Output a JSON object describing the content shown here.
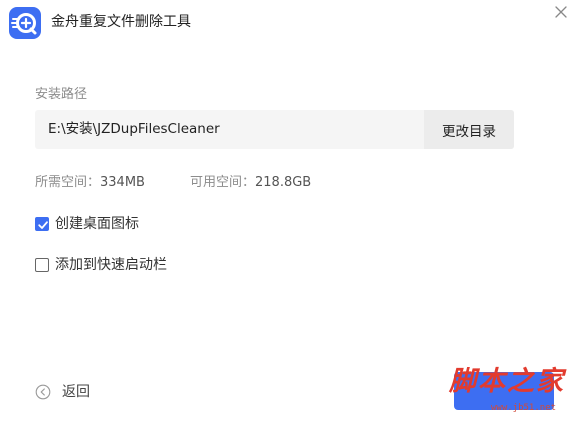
{
  "window": {
    "title": "金舟重复文件删除工具",
    "logo_icon": "app-logo-icon",
    "close_icon": "close-icon"
  },
  "install_path": {
    "label": "安装路径",
    "value": "E:\\安装\\JZDupFilesCleaner",
    "change_button": "更改目录"
  },
  "space": {
    "required_label": "所需空间：",
    "required_value": "334MB",
    "available_label": "可用空间：",
    "available_value": "218.8GB"
  },
  "options": [
    {
      "label": "创建桌面图标",
      "checked": true
    },
    {
      "label": "添加到快速启动栏",
      "checked": false
    }
  ],
  "footer": {
    "back_label": "返回",
    "back_icon": "arrow-left-circle-icon"
  },
  "watermark": {
    "main": "脚本之家",
    "sub": "www.jb51.net"
  },
  "colors": {
    "accent": "#3d6ef2",
    "watermark": "#e23b2e"
  }
}
